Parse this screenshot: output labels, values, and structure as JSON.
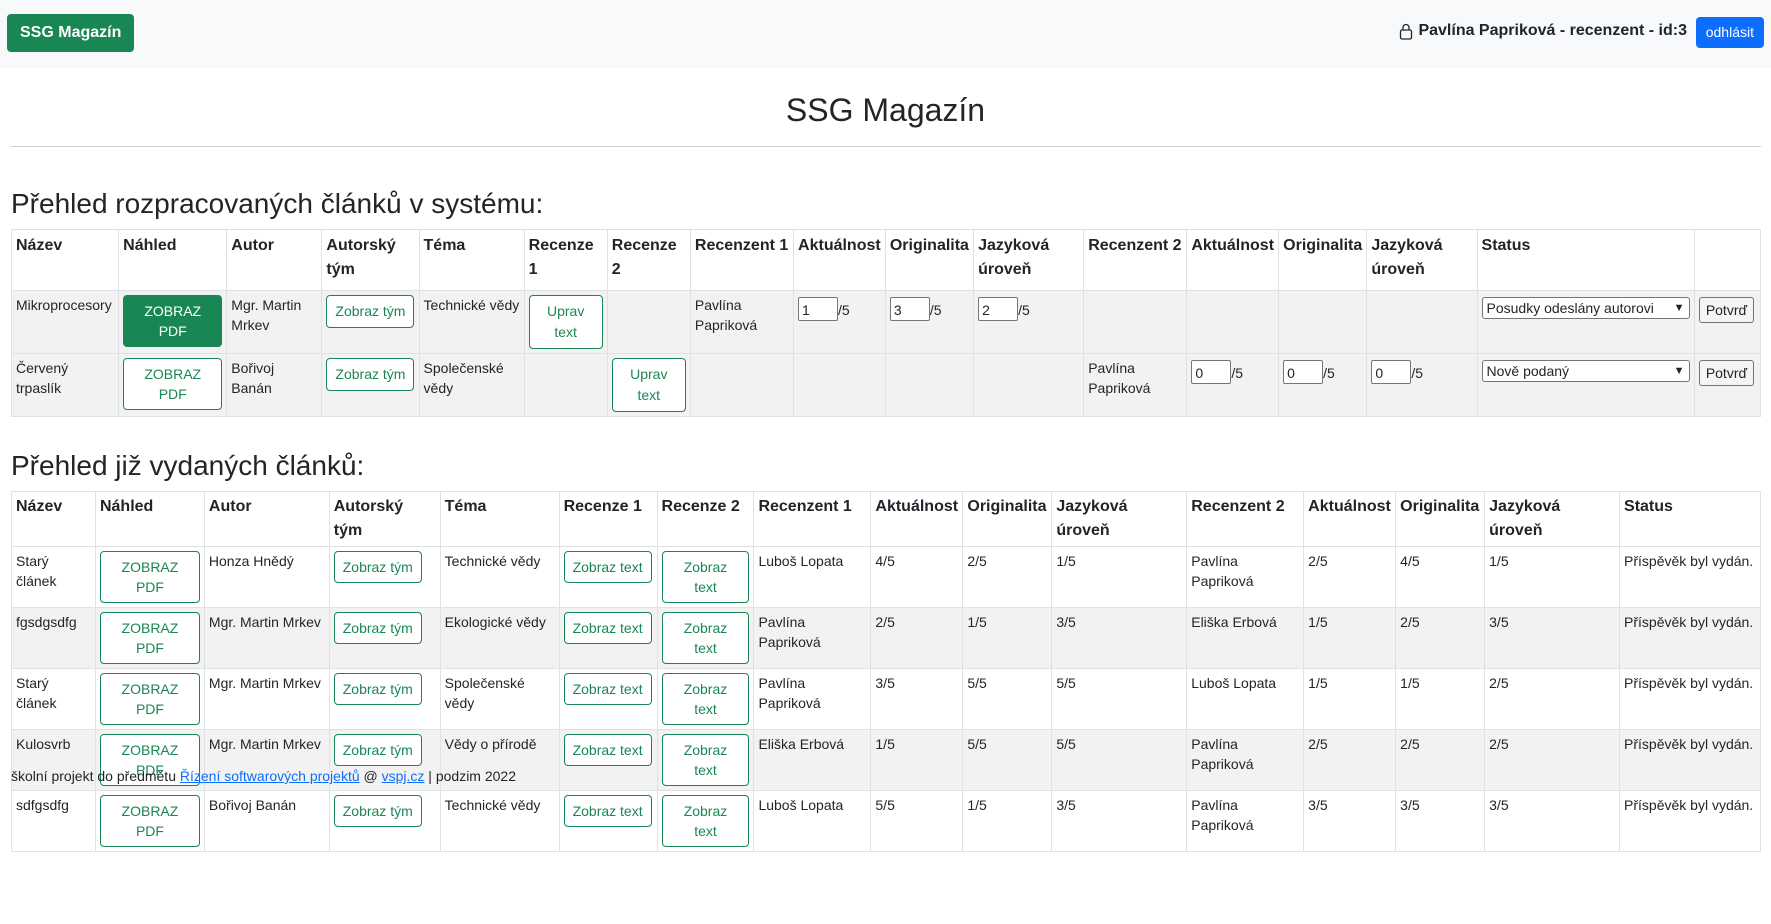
{
  "header": {
    "brand": "SSG Magazín",
    "user_label": "Pavlína Papriková - recenzent - id:3",
    "logout_label": "odhlásit"
  },
  "page_title": "SSG Magazín",
  "section1": {
    "title": "Přehled rozpracovaných článků v systému:",
    "headers": [
      "Název",
      "Náhled",
      "Autor",
      "Autorský tým",
      "Téma",
      "Recenze 1",
      "Recenze 2",
      "Recenzent 1",
      "Aktuálnost",
      "Originalita",
      "Jazyková úroveň",
      "Recenzent 2",
      "Aktuálnost",
      "Originalita",
      "Jazyková úroveň",
      "Status",
      ""
    ],
    "rows": [
      {
        "name": "Mikroprocesory",
        "preview": "ZOBRAZ PDF",
        "author": "Mgr. Martin Mrkev",
        "team": "Zobraz tým",
        "topic": "Technické vědy",
        "review1": "Uprav text",
        "review2": "",
        "reviewer1": "Pavlína Papriková",
        "r1_akt": "1",
        "r1_orig": "3",
        "r1_jaz": "2",
        "reviewer2": "",
        "r2_akt": "",
        "r2_orig": "",
        "r2_jaz": "",
        "status": "Posudky odeslány autorovi",
        "confirm": "Potvrď"
      },
      {
        "name": "Červený trpaslík",
        "preview": "ZOBRAZ PDF",
        "author": "Bořivoj Banán",
        "team": "Zobraz tým",
        "topic": "Společenské vědy",
        "review1": "",
        "review2": "Uprav text",
        "reviewer1": "",
        "r1_akt": "",
        "r1_orig": "",
        "r1_jaz": "",
        "reviewer2": "Pavlína Papriková",
        "r2_akt": "0",
        "r2_orig": "0",
        "r2_jaz": "0",
        "status": "Nově podaný",
        "confirm": "Potvrď"
      }
    ],
    "score_suffix": "/5"
  },
  "section2": {
    "title": "Přehled již vydaných článků:",
    "headers": [
      "Název",
      "Náhled",
      "Autor",
      "Autorský tým",
      "Téma",
      "Recenze 1",
      "Recenze 2",
      "Recenzent 1",
      "Aktuálnost",
      "Originalita",
      "Jazyková úroveň",
      "Recenzent 2",
      "Aktuálnost",
      "Originalita",
      "Jazyková úroveň",
      "Status"
    ],
    "preview_label": "ZOBRAZ PDF",
    "team_label": "Zobraz tým",
    "review_label": "Zobraz text",
    "rows": [
      {
        "name": "Starý článek",
        "author": "Honza Hnědý",
        "topic": "Technické vědy",
        "reviewer1": "Luboš Lopata",
        "a1": "4/5",
        "o1": "2/5",
        "j1": "1/5",
        "reviewer2": "Pavlína Papriková",
        "a2": "2/5",
        "o2": "4/5",
        "j2": "1/5",
        "status": "Příspěvěk byl vydán."
      },
      {
        "name": "fgsdgsdfg",
        "author": "Mgr. Martin Mrkev",
        "topic": "Ekologické vědy",
        "reviewer1": "Pavlína Papriková",
        "a1": "2/5",
        "o1": "1/5",
        "j1": "3/5",
        "reviewer2": "Eliška Erbová",
        "a2": "1/5",
        "o2": "2/5",
        "j2": "3/5",
        "status": "Příspěvěk byl vydán."
      },
      {
        "name": "Starý článek",
        "author": "Mgr. Martin Mrkev",
        "topic": "Společenské vědy",
        "reviewer1": "Pavlína Papriková",
        "a1": "3/5",
        "o1": "5/5",
        "j1": "5/5",
        "reviewer2": "Luboš Lopata",
        "a2": "1/5",
        "o2": "1/5",
        "j2": "2/5",
        "status": "Příspěvěk byl vydán."
      },
      {
        "name": "Kulosvrb",
        "author": "Mgr. Martin Mrkev",
        "topic": "Vědy o přírodě",
        "reviewer1": "Eliška Erbová",
        "a1": "1/5",
        "o1": "5/5",
        "j1": "5/5",
        "reviewer2": "Pavlína Papriková",
        "a2": "2/5",
        "o2": "2/5",
        "j2": "2/5",
        "status": "Příspěvěk byl vydán."
      },
      {
        "name": "sdfgsdfg",
        "author": "Bořivoj Banán",
        "topic": "Technické vědy",
        "reviewer1": "Luboš Lopata",
        "a1": "5/5",
        "o1": "1/5",
        "j1": "3/5",
        "reviewer2": "Pavlína Papriková",
        "a2": "3/5",
        "o2": "3/5",
        "j2": "3/5",
        "status": "Příspěvěk byl vydán."
      }
    ]
  },
  "footer": {
    "text1": "školní projekt do předmětu ",
    "link1": "Řízení softwarových projektů",
    "text2": " @ ",
    "link2": "vspj.cz",
    "text3": " | podzim 2022"
  },
  "colors": {
    "brand_green": "#198754",
    "primary_blue": "#0d6efd",
    "topbar_bg": "#f8f9fa"
  },
  "icons": [
    "lock-icon"
  ]
}
